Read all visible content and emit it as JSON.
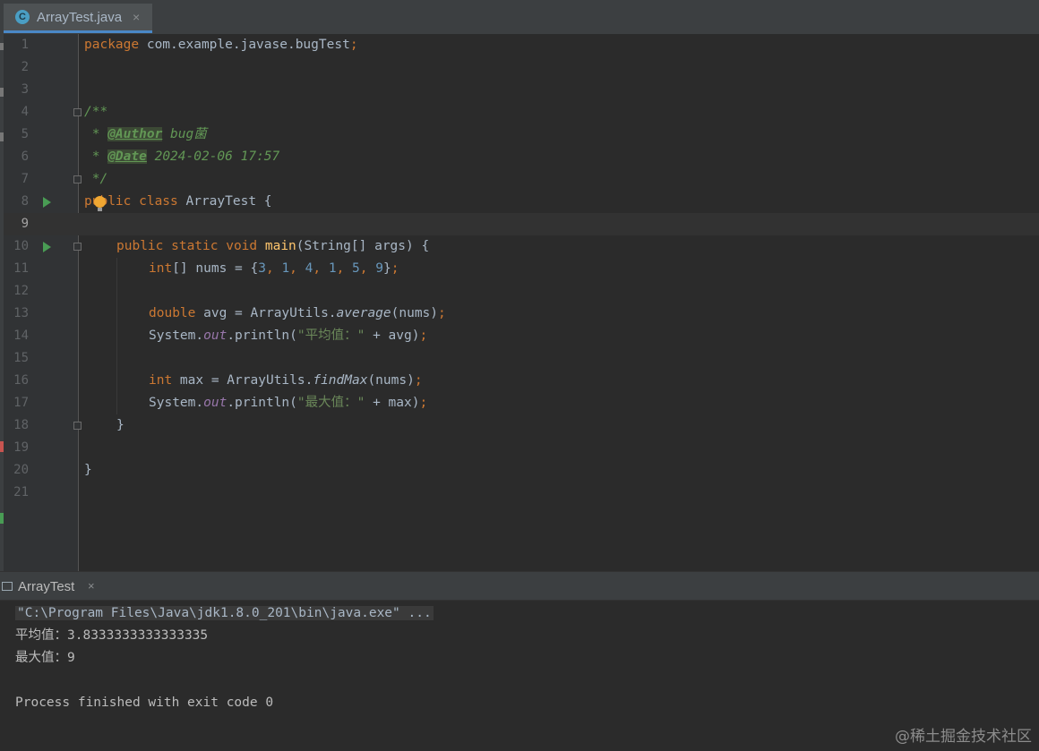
{
  "tab": {
    "icon": "java-class-icon",
    "title": "ArrayTest.java",
    "close": "×"
  },
  "editor": {
    "line_numbers": [
      "1",
      "2",
      "3",
      "4",
      "5",
      "6",
      "7",
      "8",
      "9",
      "10",
      "11",
      "12",
      "13",
      "14",
      "15",
      "16",
      "17",
      "18",
      "19",
      "20",
      "21"
    ],
    "active_line": "9",
    "code": {
      "l1_kw": "package",
      "l1_rest": " com.example.javase.bugTest",
      "l1_semi": ";",
      "l4": "/**",
      "l5_star": " * ",
      "l5_tag": "@Author",
      "l5_val": " bug菌",
      "l6_star": " * ",
      "l6_tag": "@Date",
      "l6_val": " 2024-02-06 17:57",
      "l7": " */",
      "l8_kw": "public class",
      "l8_rest": " ArrayTest {",
      "l10_kw": "public static void",
      "l10_fn": " main",
      "l10_rest": "(String[] args) {",
      "l11_kw": "int",
      "l11_a": "[] nums = {",
      "l11_n1": "3",
      "l11_n2": "1",
      "l11_n3": "4",
      "l11_n4": "1",
      "l11_n5": "5",
      "l11_n6": "9",
      "l11_c": ", ",
      "l11_end": "}",
      "semi": ";",
      "l13_kw": "double",
      "l13_a": " avg = ArrayUtils.",
      "l13_m": "average",
      "l13_b": "(nums)",
      "l14_a": "System.",
      "l14_f": "out",
      "l14_b": ".println(",
      "l14_s": "\"平均值：\"",
      "l14_c": " + avg)",
      "l16_kw": "int",
      "l16_a": " max = ArrayUtils.",
      "l16_m": "findMax",
      "l16_b": "(nums)",
      "l17_a": "System.",
      "l17_f": "out",
      "l17_b": ".println(",
      "l17_s": "\"最大值：\"",
      "l17_c": " + max)",
      "l18": "}",
      "l20": "}"
    }
  },
  "run_panel": {
    "tab_label": "ArrayTest",
    "close": "×",
    "command": "\"C:\\Program Files\\Java\\jdk1.8.0_201\\bin\\java.exe\" ...",
    "output": [
      "平均值：3.8333333333333335",
      "最大值：9"
    ],
    "exit": "Process finished with exit code 0"
  },
  "watermark": "@稀土掘金技术社区",
  "colors": {
    "background": "#2b2b2b",
    "keyword": "#cc7832",
    "number": "#6897bb",
    "string": "#6a8759",
    "doc": "#629755",
    "method": "#ffc66d"
  }
}
